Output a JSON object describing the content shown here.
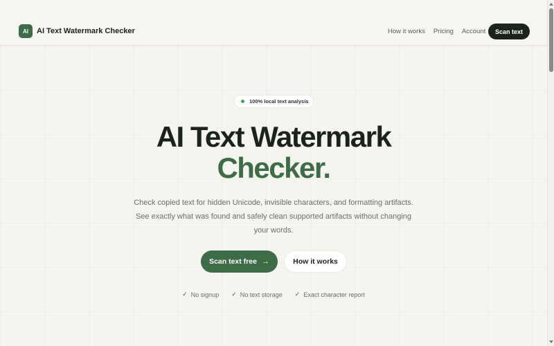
{
  "header": {
    "logo_text": "AI",
    "brand_name": "AI Text Watermark Checker",
    "nav": [
      "How it works",
      "Pricing",
      "Account"
    ],
    "cta_label": "Scan text"
  },
  "hero": {
    "badge": "100% local text analysis",
    "title_line1": "AI Text Watermark",
    "title_line2": "Checker.",
    "description_lines": [
      "Check copied text for hidden Unicode, invisible characters, and formatting artifacts.",
      "See exactly what was found and safely clean supported artifacts without changing",
      "your words."
    ],
    "primary_cta": "Scan text free",
    "primary_cta_icon": "arrow-right-icon",
    "secondary_cta": "How it works",
    "features": [
      "No signup",
      "No text storage",
      "Exact character report"
    ]
  },
  "colors": {
    "accent": "#3e6b48",
    "dark": "#1c231d",
    "background": "#f5f4ef"
  }
}
